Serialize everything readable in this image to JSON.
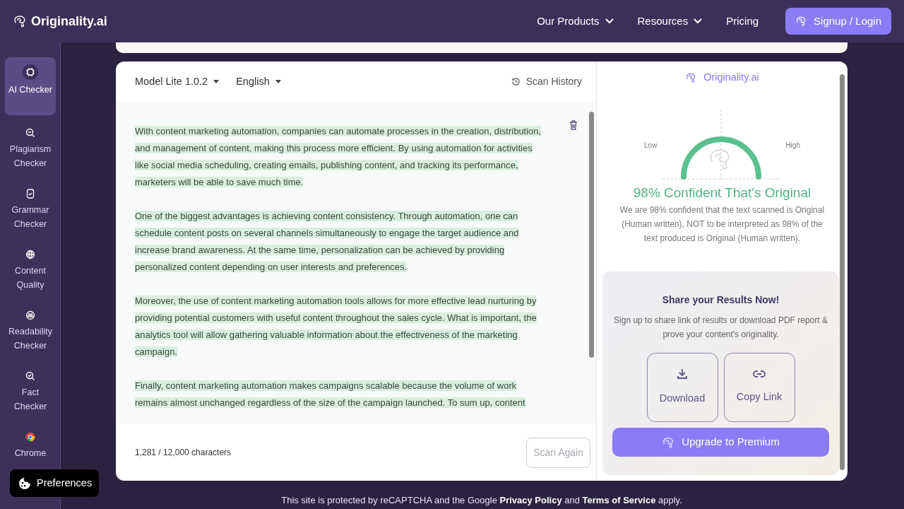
{
  "brand": {
    "name": "Originality.ai"
  },
  "nav": {
    "items": [
      {
        "label": "Our Products",
        "dropdown": true
      },
      {
        "label": "Resources",
        "dropdown": true
      },
      {
        "label": "Pricing",
        "dropdown": false
      }
    ],
    "cta": "Signup / Login"
  },
  "sidebar": {
    "items": [
      {
        "label": "AI Checker",
        "selected": true
      },
      {
        "label": "Plagiarism Checker",
        "selected": false
      },
      {
        "label": "Grammar Checker",
        "selected": false
      },
      {
        "label": "Content Quality",
        "selected": false
      },
      {
        "label": "Readability Checker",
        "selected": false
      },
      {
        "label": "Fact Checker",
        "selected": false
      },
      {
        "label": "Chrome",
        "selected": false
      }
    ]
  },
  "editor": {
    "model": "Model Lite 1.0.2",
    "language": "English",
    "history": "Scan History",
    "paragraphs": [
      {
        "text": "With content marketing automation, companies can automate processes in the creation, distribution, and management of content, making this process more efficient. By using automation for activities like social media scheduling, creating emails, publishing content, and tracking its performance, marketers will be able to save much time.",
        "highlighted": true
      },
      {
        "text": "One of the biggest advantages is achieving content consistency. Through automation, one can schedule content posts on several channels simultaneously to engage the target audience and increase brand awareness. At the same time, personalization can be achieved by providing personalized content depending on user interests and preferences.",
        "highlighted": true
      },
      {
        "text": "Moreover, the use of content marketing automation tools allows for more effective lead nurturing by providing potential customers with useful content throughout the sales cycle. What is important, the analytics tool will allow gathering valuable information about the effectiveness of the marketing campaign.",
        "highlighted": true
      },
      {
        "text": "Finally, content marketing automation makes campaigns scalable because the volume of work remains almost unchanged regardless of the size of the campaign launched. To sum up, content",
        "highlighted": true
      }
    ],
    "char_count": "1,281 / 12,000 characters",
    "scan_button": {
      "label": "Scan Again",
      "disabled": true
    }
  },
  "result": {
    "brand": "Originality.ai",
    "gauge": {
      "low": "Low",
      "high": "High"
    },
    "headline": "98% Confident That's Original",
    "description": "We are 98% confident that the text scanned is Original (Human written), NOT to be interpreted as 98% of the text produced is Original (Human written)."
  },
  "share": {
    "title": "Share your Results Now!",
    "text": "Sign up to share link of results or download PDF report & prove your content's originality.",
    "actions": [
      {
        "label": "Download"
      },
      {
        "label": "Copy Link"
      }
    ],
    "upgrade": "Upgrade to Premium"
  },
  "footer": {
    "parts": [
      {
        "kind": "text",
        "text": "This site is protected by reCAPTCHA and the Google"
      },
      {
        "kind": "link",
        "text": "Privacy Policy"
      },
      {
        "kind": "text",
        "text": "and"
      },
      {
        "kind": "link",
        "text": "Terms of Service"
      },
      {
        "kind": "text",
        "text": "apply."
      }
    ]
  },
  "cookie": {
    "label": "Preferences"
  }
}
